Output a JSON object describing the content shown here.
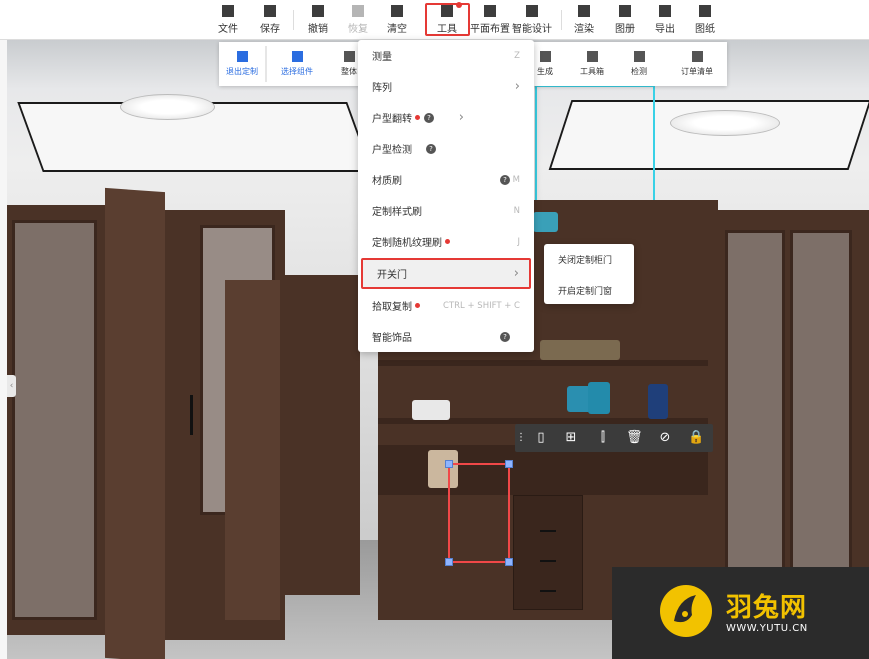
{
  "toolbar": {
    "items": [
      {
        "label": "文件",
        "icon": "file-icon"
      },
      {
        "label": "保存",
        "icon": "save-icon"
      },
      {
        "label": "撤销",
        "icon": "undo-icon"
      },
      {
        "label": "恢复",
        "icon": "redo-icon"
      },
      {
        "label": "清空",
        "icon": "eraser-icon"
      },
      {
        "label": "工具",
        "icon": "wrench-icon"
      },
      {
        "label": "平面布置",
        "icon": "floorplan-icon"
      },
      {
        "label": "智能设计",
        "icon": "lightning-icon"
      },
      {
        "label": "渲染",
        "icon": "camera-icon"
      },
      {
        "label": "图册",
        "icon": "album-icon"
      },
      {
        "label": "导出",
        "icon": "export-icon"
      },
      {
        "label": "图纸",
        "icon": "drawing-icon"
      }
    ]
  },
  "subbar": {
    "items": [
      {
        "label": "退出定制",
        "icon": "exit-icon"
      },
      {
        "label": "选择组件",
        "icon": "select-component-icon"
      },
      {
        "label": "整体",
        "icon": "whole-icon"
      },
      {
        "label": "生成",
        "icon": "generate-icon"
      },
      {
        "label": "工具箱",
        "icon": "toolbox-icon"
      },
      {
        "label": "检测",
        "icon": "detect-icon"
      },
      {
        "label": "订单清单",
        "icon": "order-list-icon"
      }
    ]
  },
  "menu": {
    "items": [
      {
        "label": "测量",
        "shortcut": "Z"
      },
      {
        "label": "阵列",
        "shortcut": "›"
      },
      {
        "label": "户型翻转",
        "shortcut": "›"
      },
      {
        "label": "户型检测",
        "shortcut": ""
      },
      {
        "label": "材质刷",
        "shortcut": "M"
      },
      {
        "label": "定制样式刷",
        "shortcut": "N"
      },
      {
        "label": "定制随机纹理刷",
        "shortcut": "J"
      },
      {
        "label": "开关门",
        "shortcut": "›"
      },
      {
        "label": "拾取复制",
        "shortcut": "CTRL + SHIFT + C"
      },
      {
        "label": "智能饰品",
        "shortcut": ""
      }
    ]
  },
  "submenu": {
    "items": [
      {
        "label": "关闭定制柜门"
      },
      {
        "label": "开启定制门窗"
      }
    ]
  },
  "watermark": {
    "title": "羽兔网",
    "url": "WWW.YUTU.CN"
  },
  "colors": {
    "accent_red": "#e53935",
    "wood": "#4a3226",
    "watermark_yellow": "#f2c200",
    "selection_blue": "#2b6de0"
  }
}
